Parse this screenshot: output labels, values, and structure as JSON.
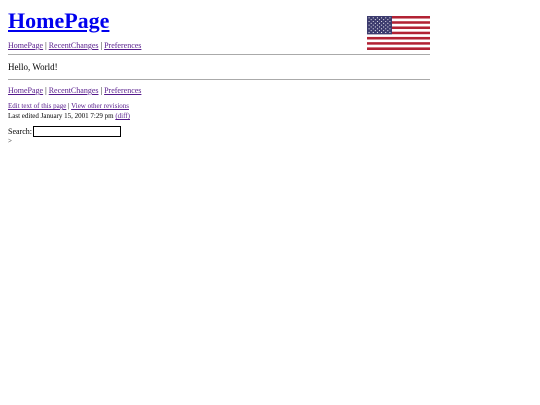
{
  "page": {
    "title": "HomePage",
    "body_text": "Hello, World!",
    "gt_text": ">"
  },
  "nav": {
    "home": "HomePage",
    "recent": "RecentChanges",
    "prefs": "Preferences",
    "separator": "|"
  },
  "footer": {
    "edit_text": "Edit text of this page",
    "view_revisions": "View other revisions",
    "last_edited": "Last edited January 15, 2001 7:29 pm",
    "diff_label": "(diff)",
    "search_label": "Search:",
    "search_value": ""
  },
  "flag": {
    "icon": "us-flag-icon",
    "stripe_red": "#b22234",
    "stripe_white": "#ffffff",
    "canton_blue": "#3c3b6e"
  },
  "colors": {
    "link": "#0000ee",
    "visited": "#551a8b"
  }
}
